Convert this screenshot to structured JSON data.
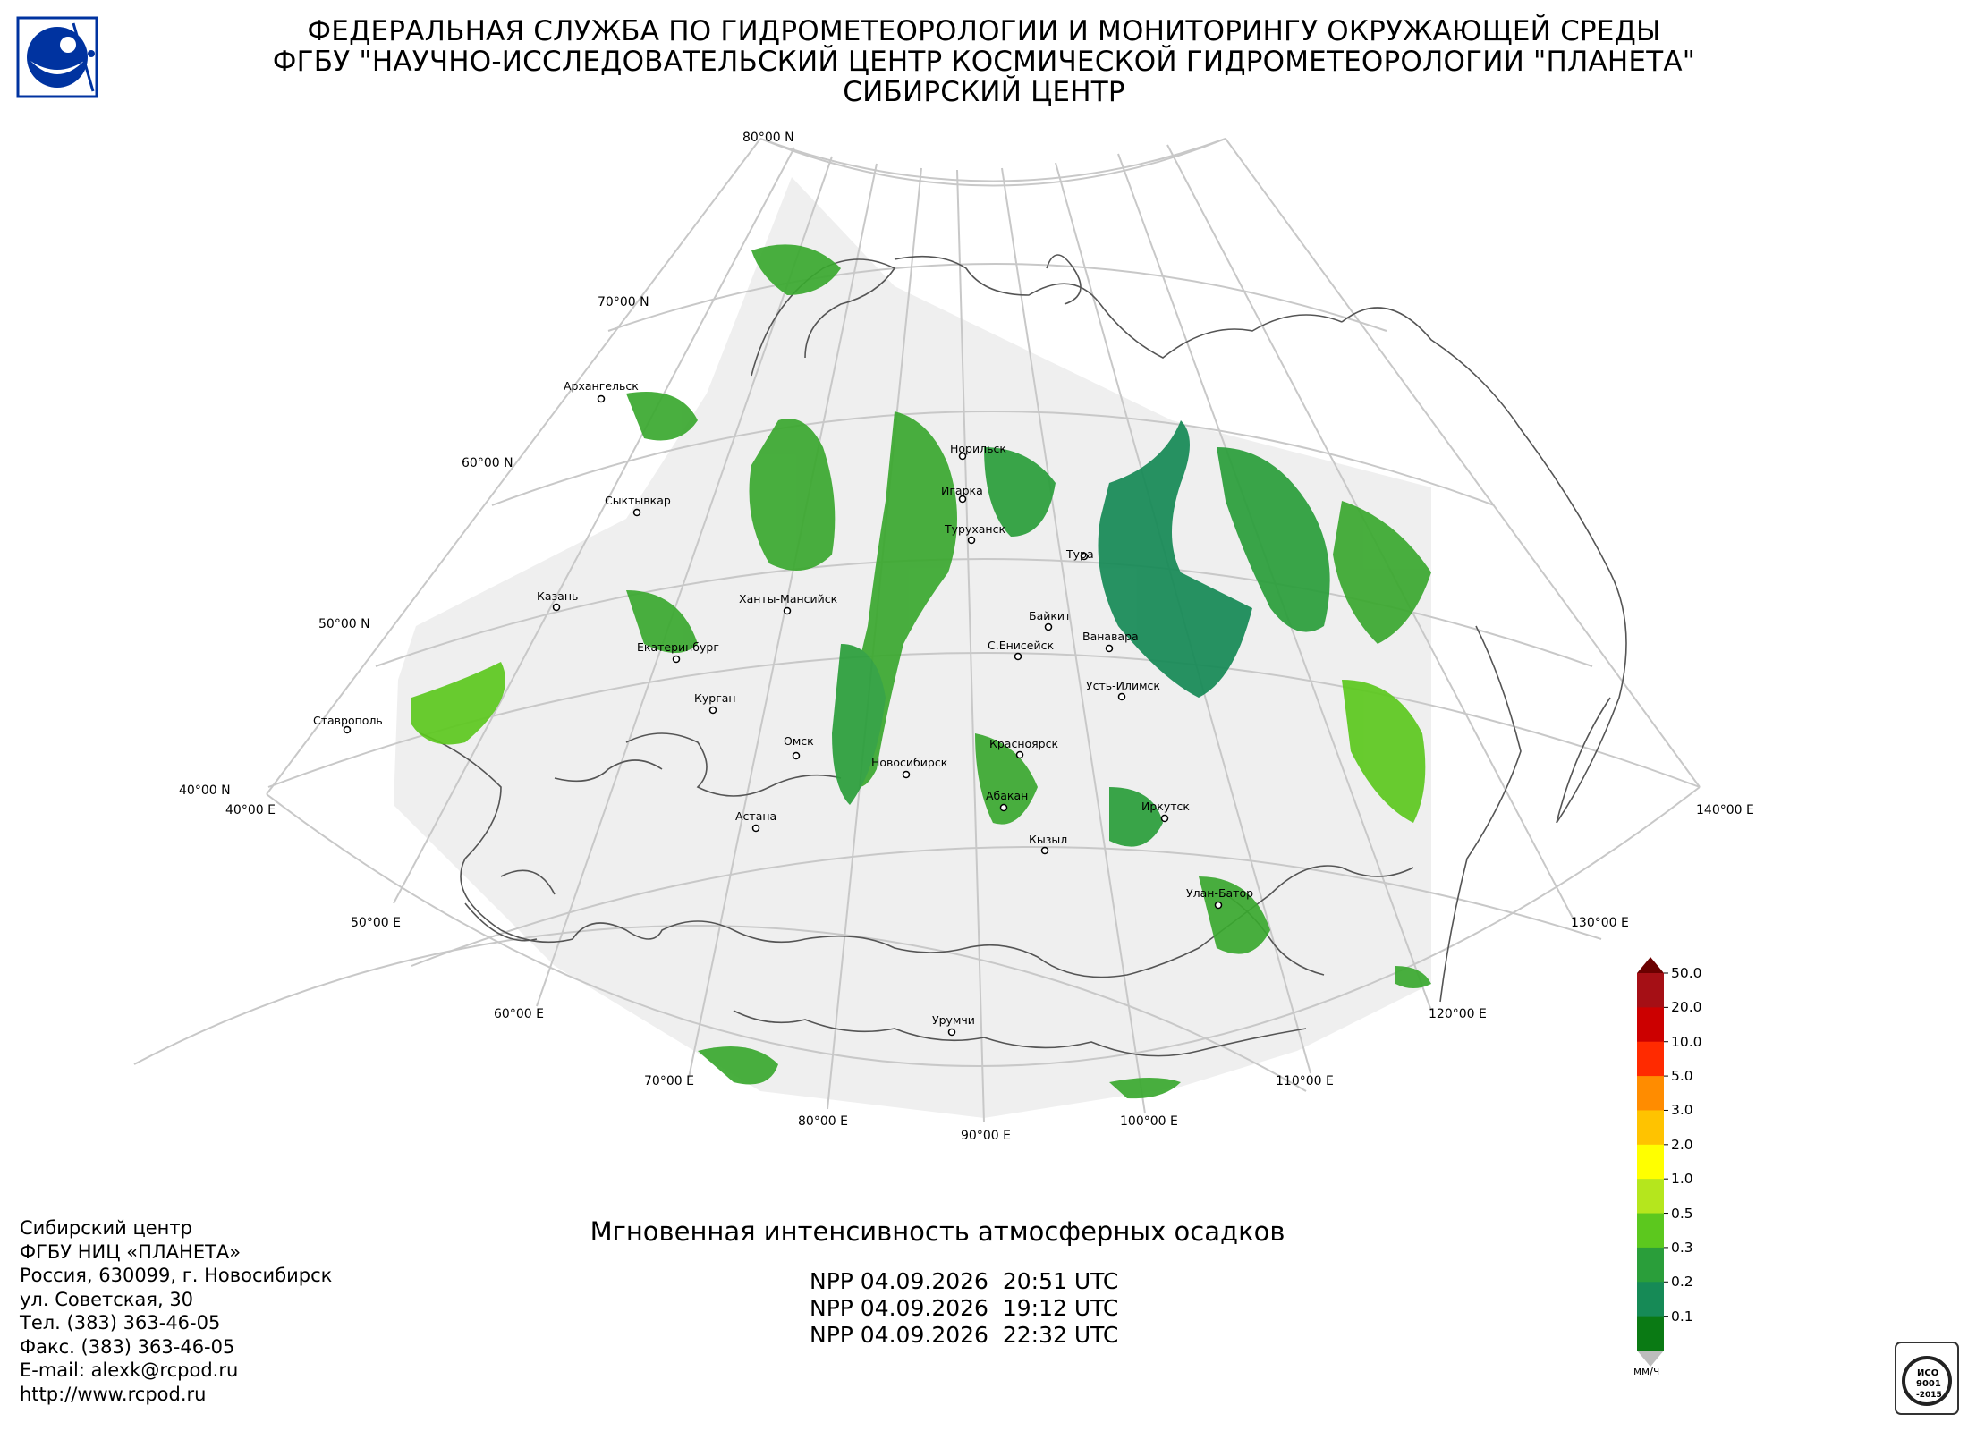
{
  "header": {
    "line1": "ФЕДЕРАЛЬНАЯ СЛУЖБА ПО ГИДРОМЕТЕОРОЛОГИИ И МОНИТОРИНГУ ОКРУЖАЮЩЕЙ СРЕДЫ",
    "line2": "ФГБУ \"НАУЧНО-ИССЛЕДОВАТЕЛЬСКИЙ ЦЕНТР КОСМИЧЕСКОЙ ГИДРОМЕТЕОРОЛОГИИ \"ПЛАНЕТА\"",
    "line3": "СИБИРСКИЙ ЦЕНТР"
  },
  "lat_labels": [
    "80°00 N",
    "70°00 N",
    "60°00 N",
    "50°00 N",
    "40°00 N"
  ],
  "lon_labels": [
    "40°00 E",
    "50°00 E",
    "60°00 E",
    "70°00 E",
    "80°00 E",
    "90°00 E",
    "100°00 E",
    "110°00 E",
    "120°00 E",
    "130°00 E",
    "140°00 E"
  ],
  "cities": [
    "Архангельск",
    "Норильск",
    "Игарка",
    "Туруханск",
    "Сыктывкар",
    "Тура",
    "Казань",
    "Ханты-Мансийск",
    "Байкит",
    "Ванавара",
    "Екатеринбург",
    "С.Енисейск",
    "Усть-Илимск",
    "Курган",
    "Ставрополь",
    "Омск",
    "Красноярск",
    "Новосибирск",
    "Абакан",
    "Иркутск",
    "Астана",
    "Кызыл",
    "Улан-Батор",
    "Урумчи"
  ],
  "footer": {
    "address": [
      "Сибирский центр",
      "ФГБУ НИЦ «ПЛАНЕТА»",
      "Россия, 630099, г. Новосибирск",
      "ул. Советская, 30",
      "Тел. (383) 363-46-05",
      "Факс. (383) 363-46-05",
      "E-mail: alexk@rcpod.ru",
      "http://www.rcpod.ru"
    ],
    "product_title": "Мгновенная интенсивность атмосферных осадков",
    "passes": [
      "NPP 04.09.2026  20:51 UTC",
      "NPP 04.09.2026  19:12 UTC",
      "NPP 04.09.2026  22:32 UTC"
    ]
  },
  "colorbar": {
    "unit": "мм/ч",
    "levels": [
      "50.0",
      "20.0",
      "10.0",
      "5.0",
      "3.0",
      "2.0",
      "1.0",
      "0.5",
      "0.3",
      "0.2",
      "0.1"
    ],
    "colors": [
      "#a50f15",
      "#cc0000",
      "#ff2a00",
      "#ff8c00",
      "#ffc300",
      "#ffff00",
      "#b5e61d",
      "#5cc81e",
      "#2a9e3a",
      "#168a56",
      "#0a7a14"
    ],
    "over_color": "#6b0000",
    "under_color": "#bdbdbd"
  },
  "iso_badge": {
    "line1": "ИСО",
    "line2": "9001",
    "line3": "-2015"
  }
}
